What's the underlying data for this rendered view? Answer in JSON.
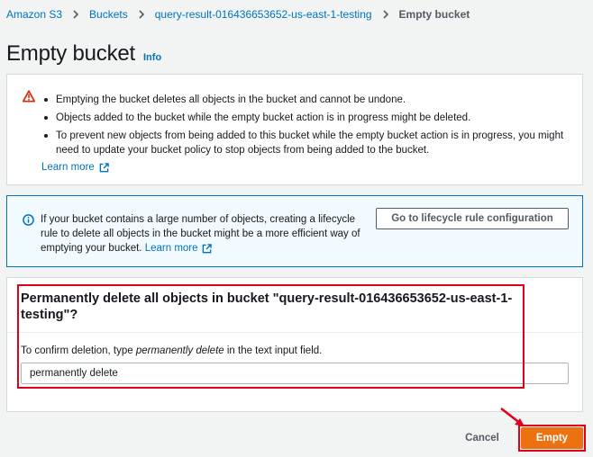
{
  "breadcrumb": {
    "items": [
      "Amazon S3",
      "Buckets",
      "query-result-016436653652-us-east-1-testing"
    ],
    "current": "Empty bucket"
  },
  "page": {
    "title": "Empty bucket",
    "info_link": "Info"
  },
  "warning": {
    "icon": "warning-triangle-icon",
    "bullets": [
      "Emptying the bucket deletes all objects in the bucket and cannot be undone.",
      "Objects added to the bucket while the empty bucket action is in progress might be deleted.",
      "To prevent new objects from being added to this bucket while the empty bucket action is in progress, you might need to update your bucket policy to stop objects from being added to the bucket."
    ],
    "learn_more": "Learn more"
  },
  "info": {
    "icon": "info-circle-icon",
    "text": "If your bucket contains a large number of objects, creating a lifecycle rule to delete all objects in the bucket might be a more efficient way of emptying your bucket.",
    "learn_more": "Learn more",
    "button_label": "Go to lifecycle rule configuration"
  },
  "confirm": {
    "title": "Permanently delete all objects in bucket \"query-result-016436653652-us-east-1-testing\"?",
    "instruction_prefix": "To confirm deletion, type ",
    "instruction_keyword": "permanently delete",
    "instruction_suffix": " in the text input field.",
    "input_value": "permanently delete"
  },
  "footer": {
    "cancel_label": "Cancel",
    "empty_label": "Empty"
  },
  "colors": {
    "link": "#0073bb",
    "primary_button": "#ec7211",
    "annotation": "#e0001b",
    "warning": "#d13212"
  }
}
